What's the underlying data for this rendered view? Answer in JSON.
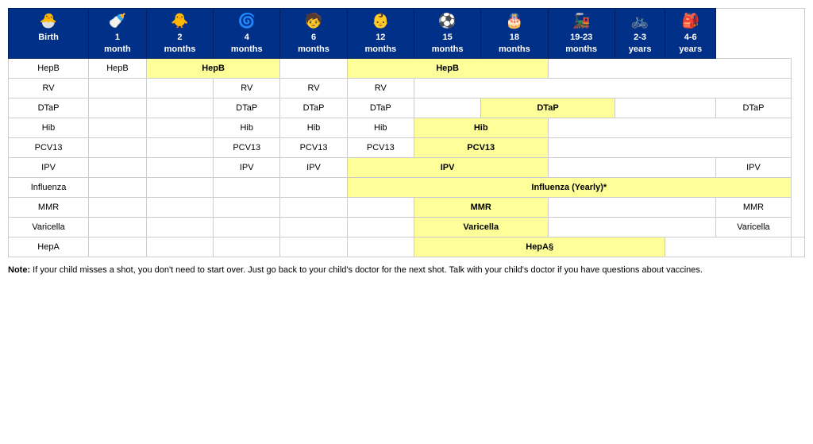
{
  "table": {
    "headers": [
      {
        "id": "birth",
        "line1": "Birth",
        "line2": "",
        "icon": "🐣"
      },
      {
        "id": "1mo",
        "line1": "1",
        "line2": "month",
        "icon": "🍼"
      },
      {
        "id": "2mo",
        "line1": "2",
        "line2": "months",
        "icon": "🐥"
      },
      {
        "id": "4mo",
        "line1": "4",
        "line2": "months",
        "icon": "🌀"
      },
      {
        "id": "6mo",
        "line1": "6",
        "line2": "months",
        "icon": "🧒"
      },
      {
        "id": "12mo",
        "line1": "12",
        "line2": "months",
        "icon": "👶"
      },
      {
        "id": "15mo",
        "line1": "15",
        "line2": "months",
        "icon": "⚽"
      },
      {
        "id": "18mo",
        "line1": "18",
        "line2": "months",
        "icon": "🎂"
      },
      {
        "id": "19-23mo",
        "line1": "19-23",
        "line2": "months",
        "icon": "🚂"
      },
      {
        "id": "2-3yr",
        "line1": "2-3",
        "line2": "years",
        "icon": "🚲"
      },
      {
        "id": "4-6yr",
        "line1": "4-6",
        "line2": "years",
        "icon": "🎒"
      }
    ],
    "rows": [
      {
        "vaccine": "HepB",
        "cells": [
          {
            "col": "birth",
            "text": "",
            "type": "empty"
          },
          {
            "col": "1mo",
            "text": "HepB",
            "type": "yellow",
            "span": 2
          },
          {
            "col": "4mo",
            "text": "",
            "type": "empty"
          },
          {
            "col": "6mo",
            "text": "HepB",
            "type": "yellow",
            "span": 3
          },
          {
            "col": "15mo",
            "text": "",
            "type": "skip"
          },
          {
            "col": "18mo",
            "text": "",
            "type": "empty"
          },
          {
            "col": "19-23mo",
            "text": "",
            "type": "empty"
          },
          {
            "col": "2-3yr",
            "text": "",
            "type": "empty"
          },
          {
            "col": "4-6yr",
            "text": "",
            "type": "empty"
          }
        ]
      },
      {
        "vaccine": "RV",
        "cells": [
          {
            "col": "birth",
            "text": "",
            "type": "empty"
          },
          {
            "col": "1mo",
            "text": "",
            "type": "empty"
          },
          {
            "col": "2mo",
            "text": "RV",
            "type": "normal"
          },
          {
            "col": "4mo",
            "text": "RV",
            "type": "normal"
          },
          {
            "col": "6mo",
            "text": "RV",
            "type": "normal"
          },
          {
            "col": "12mo",
            "text": "",
            "type": "empty"
          },
          {
            "col": "15mo",
            "text": "",
            "type": "empty"
          },
          {
            "col": "18mo",
            "text": "",
            "type": "empty"
          },
          {
            "col": "19-23mo",
            "text": "",
            "type": "empty"
          },
          {
            "col": "2-3yr",
            "text": "",
            "type": "empty"
          },
          {
            "col": "4-6yr",
            "text": "",
            "type": "empty"
          }
        ]
      },
      {
        "vaccine": "DTaP",
        "cells": [
          {
            "col": "birth",
            "text": "",
            "type": "empty"
          },
          {
            "col": "1mo",
            "text": "",
            "type": "empty"
          },
          {
            "col": "2mo",
            "text": "DTaP",
            "type": "normal"
          },
          {
            "col": "4mo",
            "text": "DTaP",
            "type": "normal"
          },
          {
            "col": "6mo",
            "text": "DTaP",
            "type": "normal"
          },
          {
            "col": "12mo",
            "text": "",
            "type": "empty"
          },
          {
            "col": "15mo",
            "text": "DTaP",
            "type": "yellow",
            "span": 2
          },
          {
            "col": "18mo",
            "text": "",
            "type": "skip"
          },
          {
            "col": "19-23mo",
            "text": "",
            "type": "empty"
          },
          {
            "col": "2-3yr",
            "text": "",
            "type": "empty"
          },
          {
            "col": "4-6yr",
            "text": "DTaP",
            "type": "normal"
          }
        ]
      },
      {
        "vaccine": "Hib",
        "cells": [
          {
            "col": "birth",
            "text": "",
            "type": "empty"
          },
          {
            "col": "1mo",
            "text": "",
            "type": "empty"
          },
          {
            "col": "2mo",
            "text": "Hib",
            "type": "normal"
          },
          {
            "col": "4mo",
            "text": "Hib",
            "type": "normal"
          },
          {
            "col": "6mo",
            "text": "Hib",
            "type": "normal"
          },
          {
            "col": "12mo",
            "text": "Hib",
            "type": "yellow",
            "span": 2
          },
          {
            "col": "15mo",
            "text": "",
            "type": "skip"
          },
          {
            "col": "18mo",
            "text": "",
            "type": "empty"
          },
          {
            "col": "19-23mo",
            "text": "",
            "type": "empty"
          },
          {
            "col": "2-3yr",
            "text": "",
            "type": "empty"
          },
          {
            "col": "4-6yr",
            "text": "",
            "type": "empty"
          }
        ]
      },
      {
        "vaccine": "PCV13",
        "cells": [
          {
            "col": "birth",
            "text": "",
            "type": "empty"
          },
          {
            "col": "1mo",
            "text": "",
            "type": "empty"
          },
          {
            "col": "2mo",
            "text": "PCV13",
            "type": "normal"
          },
          {
            "col": "4mo",
            "text": "PCV13",
            "type": "normal"
          },
          {
            "col": "6mo",
            "text": "PCV13",
            "type": "normal"
          },
          {
            "col": "12mo",
            "text": "PCV13",
            "type": "yellow",
            "span": 2
          },
          {
            "col": "15mo",
            "text": "",
            "type": "skip"
          },
          {
            "col": "18mo",
            "text": "",
            "type": "empty"
          },
          {
            "col": "19-23mo",
            "text": "",
            "type": "empty"
          },
          {
            "col": "2-3yr",
            "text": "",
            "type": "empty"
          },
          {
            "col": "4-6yr",
            "text": "",
            "type": "empty"
          }
        ]
      },
      {
        "vaccine": "IPV",
        "cells": [
          {
            "col": "birth",
            "text": "",
            "type": "empty"
          },
          {
            "col": "1mo",
            "text": "",
            "type": "empty"
          },
          {
            "col": "2mo",
            "text": "IPV",
            "type": "normal"
          },
          {
            "col": "4mo",
            "text": "IPV",
            "type": "normal"
          },
          {
            "col": "6mo",
            "text": "IPV",
            "type": "yellow",
            "span": 3
          },
          {
            "col": "12mo",
            "text": "",
            "type": "skip"
          },
          {
            "col": "15mo",
            "text": "",
            "type": "skip"
          },
          {
            "col": "18mo",
            "text": "",
            "type": "empty"
          },
          {
            "col": "19-23mo",
            "text": "",
            "type": "empty"
          },
          {
            "col": "2-3yr",
            "text": "",
            "type": "empty"
          },
          {
            "col": "4-6yr",
            "text": "IPV",
            "type": "normal"
          }
        ]
      },
      {
        "vaccine": "Influenza",
        "cells": [
          {
            "col": "birth",
            "text": "",
            "type": "empty"
          },
          {
            "col": "1mo",
            "text": "",
            "type": "empty"
          },
          {
            "col": "2mo",
            "text": "",
            "type": "empty"
          },
          {
            "col": "4mo",
            "text": "",
            "type": "empty"
          },
          {
            "col": "6mo",
            "text": "Influenza (Yearly)*",
            "type": "yellow",
            "span": 7
          }
        ]
      },
      {
        "vaccine": "MMR",
        "cells": [
          {
            "col": "birth",
            "text": "",
            "type": "empty"
          },
          {
            "col": "1mo",
            "text": "",
            "type": "empty"
          },
          {
            "col": "2mo",
            "text": "",
            "type": "empty"
          },
          {
            "col": "4mo",
            "text": "",
            "type": "empty"
          },
          {
            "col": "6mo",
            "text": "",
            "type": "empty"
          },
          {
            "col": "12mo",
            "text": "MMR",
            "type": "yellow",
            "span": 2
          },
          {
            "col": "15mo",
            "text": "",
            "type": "skip"
          },
          {
            "col": "18mo",
            "text": "",
            "type": "empty"
          },
          {
            "col": "19-23mo",
            "text": "",
            "type": "empty"
          },
          {
            "col": "2-3yr",
            "text": "",
            "type": "empty"
          },
          {
            "col": "4-6yr",
            "text": "MMR",
            "type": "normal"
          }
        ]
      },
      {
        "vaccine": "Varicella",
        "cells": [
          {
            "col": "birth",
            "text": "",
            "type": "empty"
          },
          {
            "col": "1mo",
            "text": "",
            "type": "empty"
          },
          {
            "col": "2mo",
            "text": "",
            "type": "empty"
          },
          {
            "col": "4mo",
            "text": "",
            "type": "empty"
          },
          {
            "col": "6mo",
            "text": "",
            "type": "empty"
          },
          {
            "col": "12mo",
            "text": "Varicella",
            "type": "yellow",
            "span": 2
          },
          {
            "col": "15mo",
            "text": "",
            "type": "skip"
          },
          {
            "col": "18mo",
            "text": "",
            "type": "empty"
          },
          {
            "col": "19-23mo",
            "text": "",
            "type": "empty"
          },
          {
            "col": "2-3yr",
            "text": "",
            "type": "empty"
          },
          {
            "col": "4-6yr",
            "text": "Varicella",
            "type": "normal"
          }
        ]
      },
      {
        "vaccine": "HepA",
        "cells": [
          {
            "col": "birth",
            "text": "",
            "type": "empty"
          },
          {
            "col": "1mo",
            "text": "",
            "type": "empty"
          },
          {
            "col": "2mo",
            "text": "",
            "type": "empty"
          },
          {
            "col": "4mo",
            "text": "",
            "type": "empty"
          },
          {
            "col": "6mo",
            "text": "",
            "type": "empty"
          },
          {
            "col": "12mo",
            "text": "HepA§",
            "type": "yellow",
            "span": 4
          },
          {
            "col": "15mo",
            "text": "",
            "type": "skip"
          },
          {
            "col": "18mo",
            "text": "",
            "type": "skip"
          },
          {
            "col": "19-23mo",
            "text": "",
            "type": "skip"
          },
          {
            "col": "2-3yr",
            "text": "",
            "type": "empty"
          },
          {
            "col": "4-6yr",
            "text": "",
            "type": "empty"
          }
        ]
      }
    ],
    "note": "Note: If your child misses a shot, you don't need to start over. Just go back to your child's doctor for the next shot. Talk with your child's doctor if you have questions about vaccines."
  }
}
